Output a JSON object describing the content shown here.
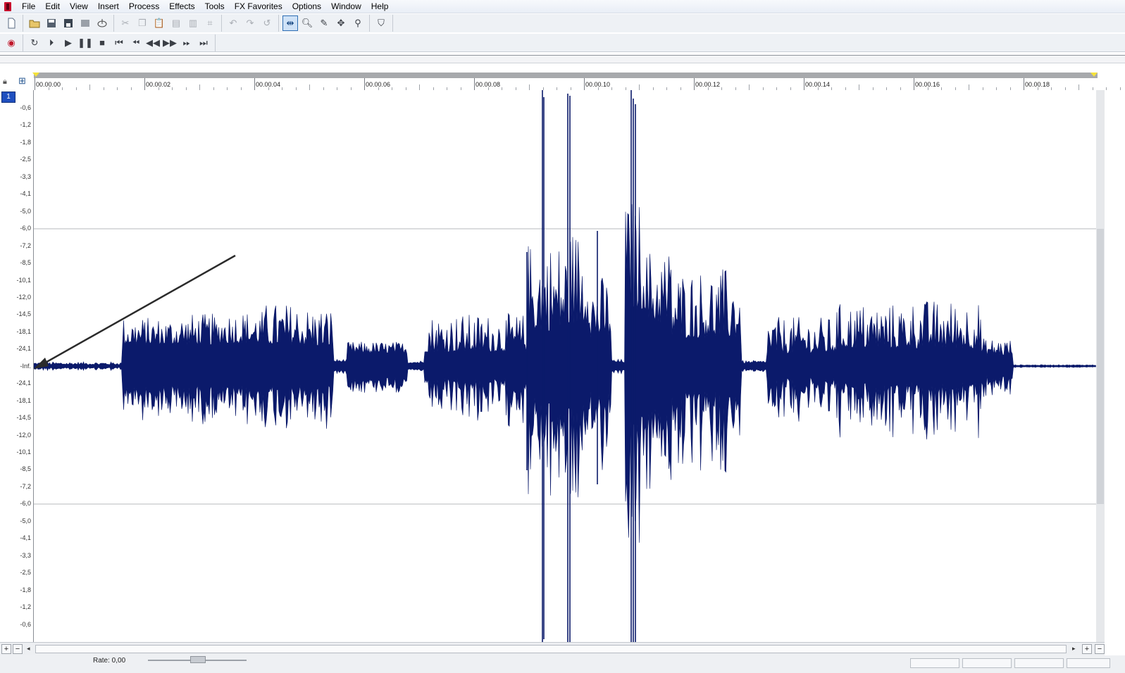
{
  "menu": [
    "File",
    "Edit",
    "View",
    "Insert",
    "Process",
    "Effects",
    "Tools",
    "FX Favorites",
    "Options",
    "Window",
    "Help"
  ],
  "icons": {
    "app": "app-icon",
    "toolbar1": [
      "new-file-icon",
      "open-file-icon",
      "save-icon",
      "save-as-icon",
      "render-icon",
      "properties-icon",
      "cut-icon",
      "copy-icon",
      "paste-icon",
      "paste-special-icon",
      "mix-icon",
      "crop-icon",
      "undo-icon",
      "redo-icon",
      "repeat-icon",
      "edit-tool-icon",
      "magnify-tool-icon",
      "pencil-tool-icon",
      "envelope-tool-icon",
      "event-tool-icon",
      "snap-icon"
    ],
    "toolbar2": [
      "record-icon",
      "loop-icon",
      "play-all-icon",
      "play-icon",
      "pause-icon",
      "stop-icon",
      "go-to-start-icon",
      "previous-marker-icon",
      "rewind-icon",
      "fast-forward-icon",
      "next-marker-icon",
      "go-to-end-icon"
    ]
  },
  "ruler": {
    "labels": [
      "00.00.00",
      "00.00.02",
      "00.00.04",
      "00.00.06",
      "00.00.08",
      "00.00.10",
      "00.00.12",
      "00.00.14",
      "00.00.16",
      "00.00.18"
    ]
  },
  "channel": {
    "number": "1"
  },
  "db_scale": [
    "-0,6",
    "-1,2",
    "-1,8",
    "-2,5",
    "-3,3",
    "-4,1",
    "-5,0",
    "-6,0",
    "-7,2",
    "-8,5",
    "-10,1",
    "-12,0",
    "-14,5",
    "-18,1",
    "-24,1",
    "-Inf.",
    "-24,1",
    "-18,1",
    "-14,5",
    "-12,0",
    "-10,1",
    "-8,5",
    "-7,2",
    "-6,0",
    "-5,0",
    "-4,1",
    "-3,3",
    "-2,5",
    "-1,8",
    "-1,2",
    "-0,6"
  ],
  "status": {
    "rate": "Rate: 0,00"
  },
  "colors": {
    "waveform": "#0b1a6b",
    "arrow": "#2b2b2b",
    "scrubbar": "#a7a9ac",
    "marker": "#f5e23a"
  }
}
